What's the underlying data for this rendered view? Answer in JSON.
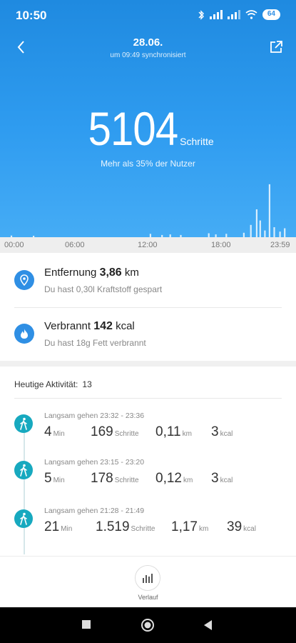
{
  "status_bar": {
    "time": "10:50",
    "battery": "64"
  },
  "header": {
    "date": "28.06.",
    "sync": "um 09:49 synchronisiert"
  },
  "summary": {
    "steps": "5104",
    "steps_unit": "Schritte",
    "comparison": "Mehr als 35% der Nutzer"
  },
  "axis_labels": [
    "00:00",
    "06:00",
    "12:00",
    "18:00",
    "23:59"
  ],
  "distance": {
    "label": "Entfernung",
    "value": "3,86",
    "unit": "km",
    "sub": "Du hast 0,30l Kraftstoff gespart"
  },
  "calories": {
    "label": "Verbrannt",
    "value": "142",
    "unit": "kcal",
    "sub": "Du hast 18g Fett verbrannt"
  },
  "activity": {
    "title": "Heutige Aktivität:",
    "count": "13"
  },
  "activities": [
    {
      "label": "Langsam gehen 23:32 - 23:36",
      "min": "4",
      "min_unit": "Min",
      "steps": "169",
      "steps_unit": "Schritte",
      "km": "0,11",
      "km_unit": "km",
      "kcal": "3",
      "kcal_unit": "kcal"
    },
    {
      "label": "Langsam gehen 23:15 - 23:20",
      "min": "5",
      "min_unit": "Min",
      "steps": "178",
      "steps_unit": "Schritte",
      "km": "0,12",
      "km_unit": "km",
      "kcal": "3",
      "kcal_unit": "kcal"
    },
    {
      "label": "Langsam gehen 21:28 - 21:49",
      "min": "21",
      "min_unit": "Min",
      "steps": "1.519",
      "steps_unit": "Schritte",
      "km": "1,17",
      "km_unit": "km",
      "kcal": "39",
      "kcal_unit": "kcal"
    }
  ],
  "bottom": {
    "history_label": "Verlauf"
  },
  "colors": {
    "hero": "#2f8fe4",
    "accent_blue": "#2f8fe4",
    "walk_teal": "#17a9bf"
  },
  "chart_data": {
    "type": "bar",
    "x_range": [
      "00:00",
      "23:59"
    ],
    "hours": [
      0.3,
      2.2,
      12.2,
      13.2,
      13.9,
      14.8,
      17.2,
      17.8,
      18.7,
      20.2,
      20.8,
      21.3,
      21.6,
      22.0,
      22.4,
      22.8,
      23.3,
      23.7
    ],
    "relative_heights": [
      0.03,
      0.02,
      0.06,
      0.04,
      0.05,
      0.04,
      0.07,
      0.05,
      0.06,
      0.08,
      0.22,
      0.5,
      0.3,
      0.12,
      0.95,
      0.18,
      0.1,
      0.16
    ]
  }
}
